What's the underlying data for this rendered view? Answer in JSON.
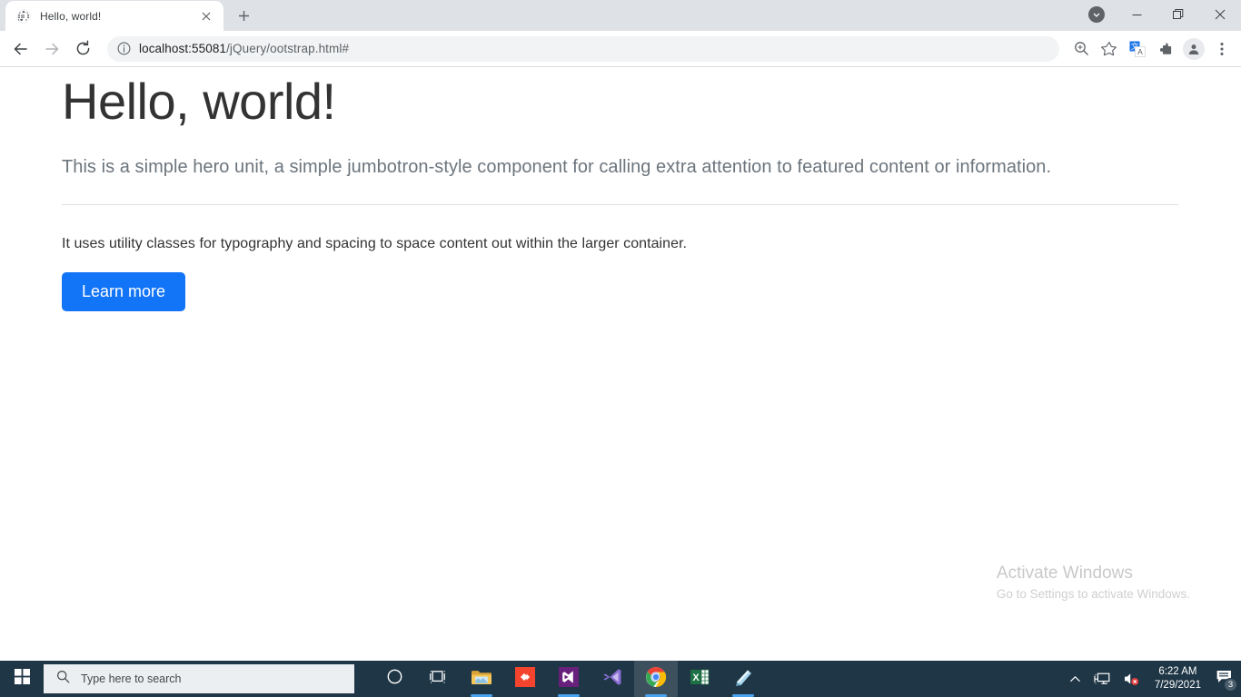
{
  "browser": {
    "tabs": [
      {
        "title": "Hello, world!",
        "favicon_icon": "globe-icon",
        "close_icon": "close-icon",
        "active": true
      }
    ],
    "new_tab_icon": "plus-icon",
    "window_controls": {
      "download_icon": "download-chevron-icon",
      "minimize_icon": "minimize-icon",
      "restore_icon": "restore-icon",
      "close_icon": "close-icon"
    },
    "toolbar": {
      "back_icon": "arrow-left-icon",
      "forward_icon": "arrow-right-icon",
      "reload_icon": "reload-icon",
      "site_info_icon": "info-circle-icon",
      "url_host": "localhost:55081",
      "url_path": "/jQuery/ootstrap.html#",
      "url_full": "localhost:55081/jQuery/ootstrap.html#",
      "zoom_icon": "zoom-magnifier-icon",
      "bookmark_icon": "star-icon",
      "translate_icon": "google-translate-icon",
      "extensions_icon": "puzzle-piece-icon",
      "profile_icon": "person-avatar-icon",
      "menu_icon": "three-dot-menu-icon"
    }
  },
  "page": {
    "heading": "Hello, world!",
    "lead": "This is a simple hero unit, a simple jumbotron-style component for calling extra attention to featured content or information.",
    "body": "It uses utility classes for typography and spacing to space content out within the larger container.",
    "button_label": "Learn more",
    "button_color": "#1274f6",
    "heading_color": "#333333",
    "lead_color": "#6c757d"
  },
  "watermark": {
    "title": "Activate Windows",
    "subtitle": "Go to Settings to activate Windows."
  },
  "taskbar": {
    "start_icon": "windows-logo-icon",
    "search": {
      "icon": "search-icon",
      "placeholder": "Type here to search"
    },
    "apps": [
      {
        "name": "cortana",
        "icon": "cortana-circle-icon",
        "running": false,
        "active": false
      },
      {
        "name": "task-view",
        "icon": "task-view-icon",
        "running": false,
        "active": false
      },
      {
        "name": "file-explorer",
        "icon": "file-explorer-icon",
        "running": true,
        "active": false
      },
      {
        "name": "resilio-sync",
        "icon": "resilio-sync-icon",
        "running": false,
        "active": false
      },
      {
        "name": "visual-studio",
        "icon": "visual-studio-icon",
        "running": true,
        "active": false
      },
      {
        "name": "vs-code",
        "icon": "vs-code-icon",
        "running": false,
        "active": false
      },
      {
        "name": "google-chrome",
        "icon": "chrome-icon",
        "running": true,
        "active": true
      },
      {
        "name": "excel",
        "icon": "excel-icon",
        "running": false,
        "active": false
      },
      {
        "name": "sticky-notes",
        "icon": "sticky-notes-icon",
        "running": true,
        "active": false
      }
    ],
    "tray": {
      "overflow_icon": "chevron-up-icon",
      "network_icon": "network-monitor-icon",
      "volume_icon": "speaker-muted-icon",
      "time": "6:22 AM",
      "date": "7/29/2021",
      "notification_icon": "action-center-icon",
      "notification_count": "3"
    }
  }
}
